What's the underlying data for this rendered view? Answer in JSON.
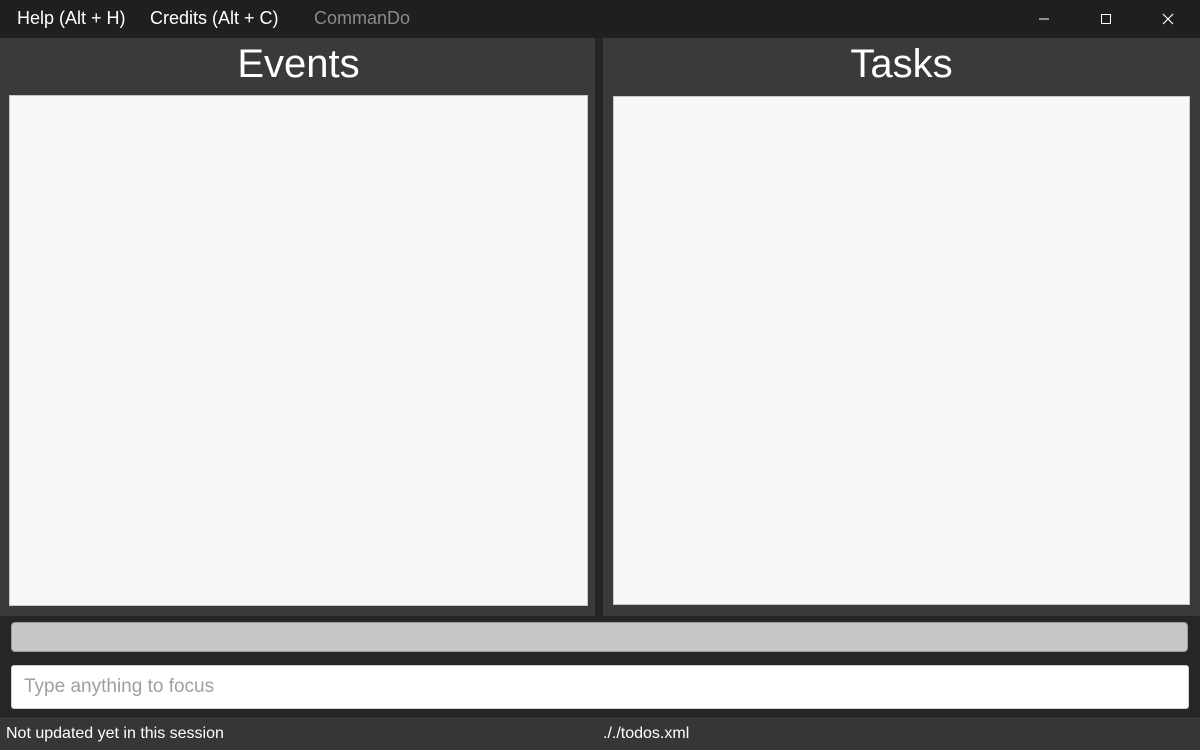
{
  "menu": {
    "help_label": "Help (Alt + H)",
    "credits_label": "Credits (Alt + C)"
  },
  "window": {
    "title": "CommanDo",
    "controls": [
      "minimize-icon",
      "maximize-icon",
      "close-icon"
    ]
  },
  "events": {
    "title": "Events"
  },
  "tasks": {
    "title": "Tasks"
  },
  "command": {
    "placeholder": "Type anything to focus",
    "value": ""
  },
  "status": {
    "sync_text": "Not updated yet in this session",
    "file_path": "././todos.xml"
  },
  "colors": {
    "titlebar": "#1f1f1f",
    "panel_background": "#3a3a3a",
    "list_background": "#f8f8f8",
    "result_bar": "#c6c6c6",
    "statusbar": "#363636"
  }
}
